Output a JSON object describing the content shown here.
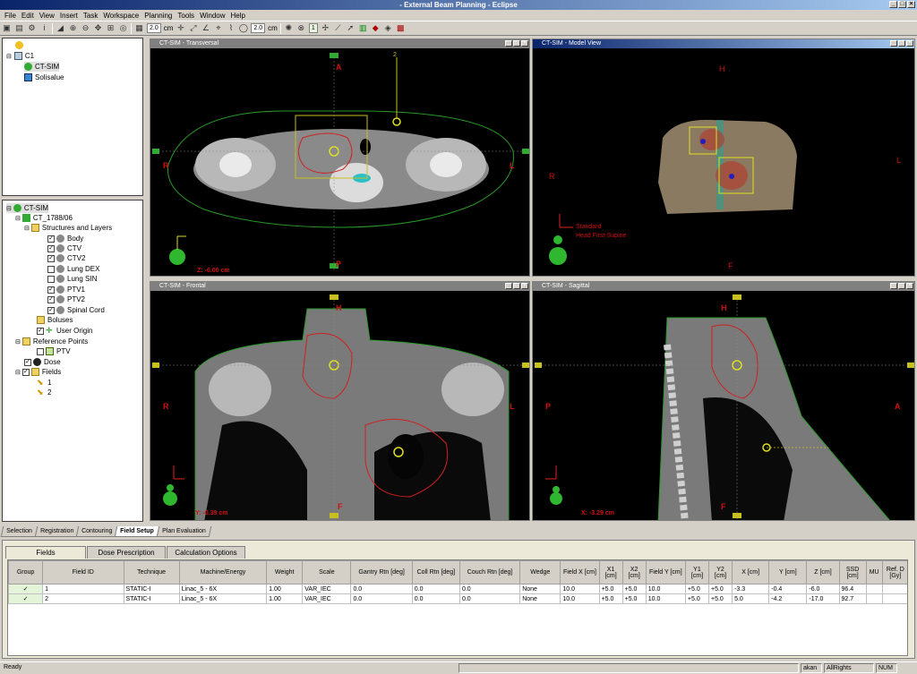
{
  "window": {
    "title": "- External Beam Planning - Eclipse"
  },
  "menu": [
    "File",
    "Edit",
    "View",
    "Insert",
    "Task",
    "Workspace",
    "Planning",
    "Tools",
    "Window",
    "Help"
  ],
  "toolbar": {
    "zoom1": "2.0",
    "unit1": "cm",
    "zoom2": "2.0",
    "unit2": "cm",
    "field": "1"
  },
  "tree_top": {
    "root": "C1",
    "items": [
      "CT-SIM",
      "Solisalue"
    ]
  },
  "tree_struct": {
    "root": "CT-SIM",
    "image": "CT_1788/06",
    "structures_label": "Structures and Layers",
    "structures": [
      {
        "name": "Body",
        "checked": true
      },
      {
        "name": "CTV",
        "checked": true
      },
      {
        "name": "CTV2",
        "checked": true
      },
      {
        "name": "Lung DEX",
        "checked": false
      },
      {
        "name": "Lung SIN",
        "checked": false
      },
      {
        "name": "PTV1",
        "checked": true
      },
      {
        "name": "PTV2",
        "checked": true
      },
      {
        "name": "Spinal Cord",
        "checked": true
      }
    ],
    "boluses": "Boluses",
    "user_origin": "User Origin",
    "ref_points": "Reference Points",
    "ref_point": "PTV",
    "dose": "Dose",
    "fields": "Fields",
    "field_items": [
      "1",
      "2"
    ]
  },
  "viewports": {
    "transversal": {
      "title": "CT-SIM - Transversal",
      "top": "A",
      "bottom": "P",
      "left": "R",
      "right": "L",
      "coord": "Z: -6.00 cm",
      "beam": "2"
    },
    "model": {
      "title": "CT-SIM - Model View",
      "top": "H",
      "bottom": "F",
      "left": "R",
      "right": "L",
      "orient1": "Standard",
      "orient2": "Head First-Supine"
    },
    "frontal": {
      "title": "CT-SIM - Frontal",
      "top": "H",
      "bottom": "F",
      "left": "R",
      "right": "L",
      "coord": "Y: -0.39 cm"
    },
    "sagittal": {
      "title": "CT-SIM - Sagittal",
      "top": "H",
      "bottom": "F",
      "left": "P",
      "right": "A",
      "coord": "X: -3.29 cm"
    }
  },
  "workspace_tabs": [
    "Selection",
    "Registration",
    "Contouring",
    "Field Setup",
    "Plan Evaluation"
  ],
  "workspace_tab_selected": "Field Setup",
  "sub_tabs": [
    "Fields",
    "Dose Prescription",
    "Calculation Options"
  ],
  "table": {
    "headers": [
      "Group",
      "Field ID",
      "Technique",
      "Machine/Energy",
      "Weight",
      "Scale",
      "Gantry Rtn [deg]",
      "Coll Rtn [deg]",
      "Couch Rtn [deg]",
      "Wedge",
      "Field X [cm]",
      "X1 [cm]",
      "X2 [cm]",
      "Field Y [cm]",
      "Y1 [cm]",
      "Y2 [cm]",
      "X [cm]",
      "Y [cm]",
      "Z [cm]",
      "SSD [cm]",
      "MU",
      "Ref. D [Gy]"
    ],
    "rows": [
      [
        "✓",
        "1",
        "STATIC-I",
        "Linac_5 - 6X",
        "1.00",
        "VAR_IEC",
        "0.0",
        "0.0",
        "0.0",
        "None",
        "10.0",
        "+5.0",
        "+5.0",
        "10.0",
        "+5.0",
        "+5.0",
        "-3.3",
        "-0.4",
        "-6.0",
        "96.4",
        "",
        ""
      ],
      [
        "✓",
        "2",
        "STATIC-I",
        "Linac_5 - 6X",
        "1.00",
        "VAR_IEC",
        "0.0",
        "0.0",
        "0.0",
        "None",
        "10.0",
        "+5.0",
        "+5.0",
        "10.0",
        "+5.0",
        "+5.0",
        "5.0",
        "-4.2",
        "-17.0",
        "92.7",
        "",
        ""
      ]
    ]
  },
  "status": {
    "left": "Ready",
    "user": "akan",
    "rights": "AllRights",
    "num": "NUM"
  }
}
